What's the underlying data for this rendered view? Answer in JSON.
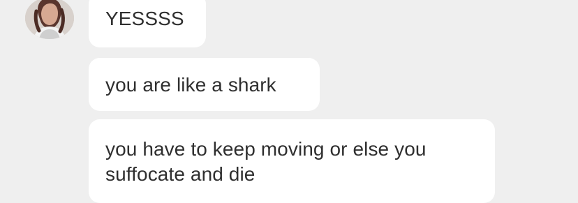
{
  "chat": {
    "messages": [
      {
        "text": "YESSSS"
      },
      {
        "text": "you are like a shark"
      },
      {
        "text": "you have to keep moving or else you suffocate and die"
      }
    ]
  },
  "colors": {
    "background": "#efefef",
    "bubble": "#ffffff",
    "text": "#2f2f2f"
  },
  "icons": {
    "avatar": "user-avatar-icon"
  }
}
